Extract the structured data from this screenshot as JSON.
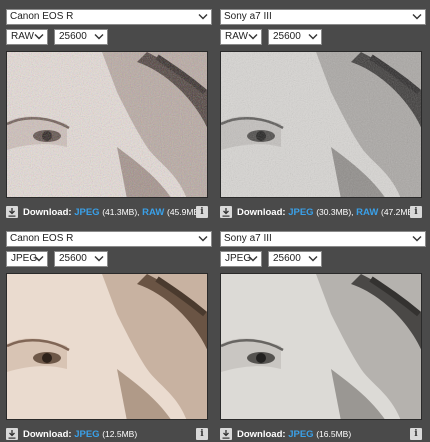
{
  "panels": [
    {
      "camera": "Canon EOS R",
      "format": "RAW",
      "iso": "25600",
      "download_label": "Download:",
      "jpeg_label": "JPEG",
      "jpeg_size": "(41.3MB),",
      "raw_label": "RAW",
      "raw_size": "(45.9MB)",
      "image_style": "noisy-color"
    },
    {
      "camera": "Sony a7 III",
      "format": "RAW",
      "iso": "25600",
      "download_label": "Download:",
      "jpeg_label": "JPEG",
      "jpeg_size": "(30.3MB),",
      "raw_label": "RAW",
      "raw_size": "(47.2MB)",
      "image_style": "noisy-gray"
    },
    {
      "camera": "Canon EOS R",
      "format": "JPEG",
      "iso": "25600",
      "download_label": "Download:",
      "jpeg_label": "JPEG",
      "jpeg_size": "(12.5MB)",
      "image_style": "smooth-warm"
    },
    {
      "camera": "Sony a7 III",
      "format": "JPEG",
      "iso": "25600",
      "download_label": "Download:",
      "jpeg_label": "JPEG",
      "jpeg_size": "(16.5MB)",
      "image_style": "smooth-gray"
    }
  ],
  "icons": {
    "download": "download-icon",
    "info": "info-icon",
    "dropdown": "chevron-down-icon"
  },
  "colors": {
    "background": "#4a4a4a",
    "link": "#3aa0e8"
  }
}
